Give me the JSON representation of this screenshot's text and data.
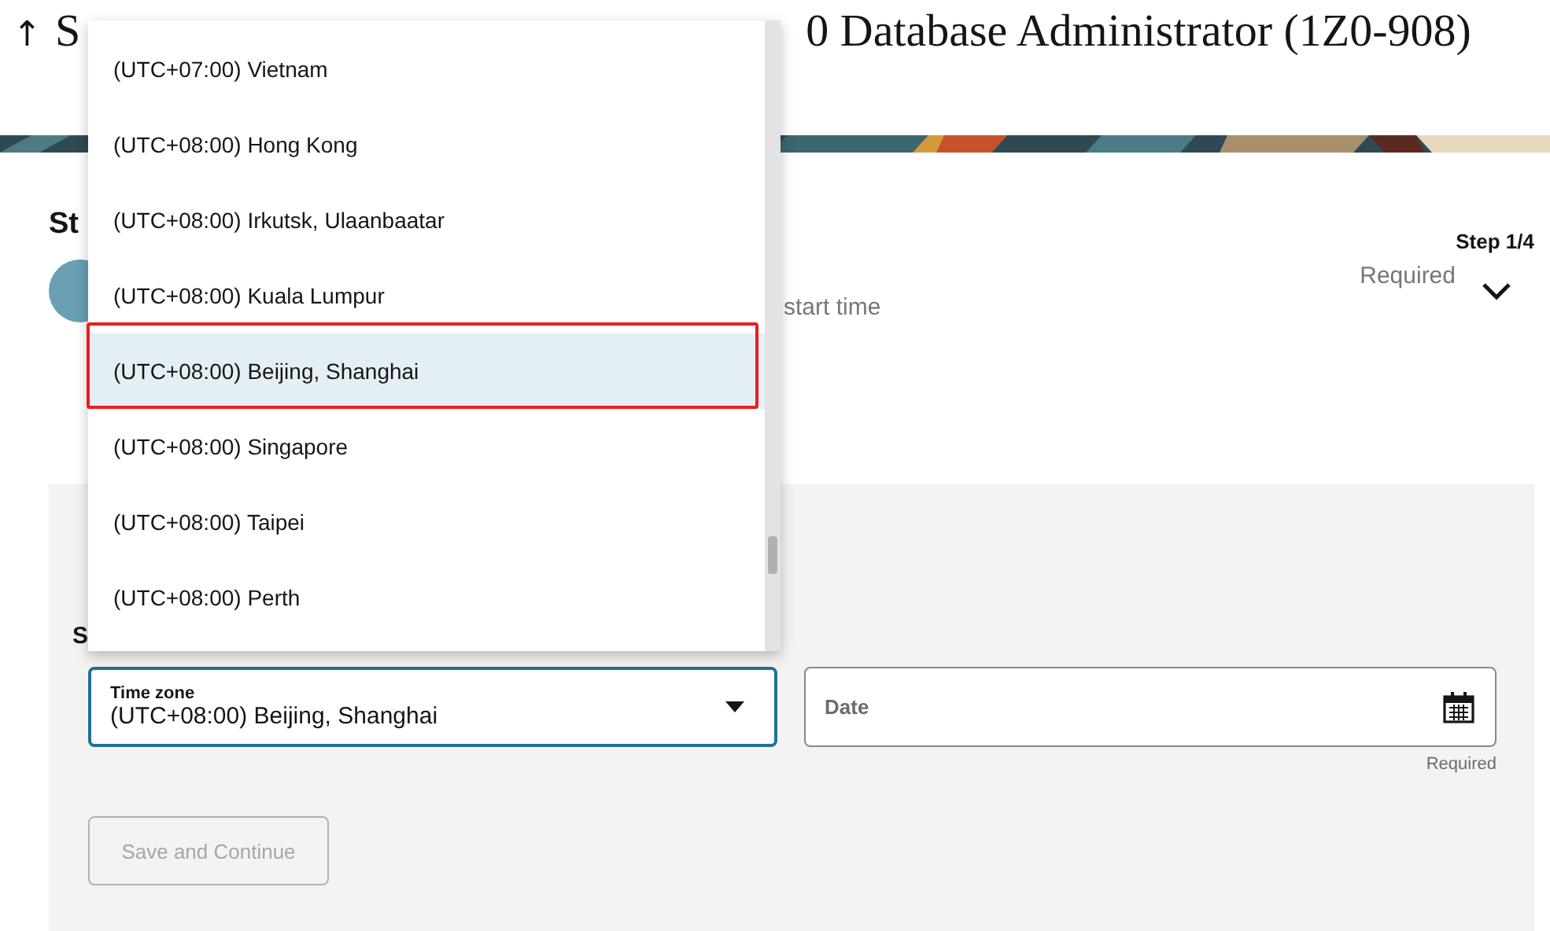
{
  "page": {
    "back_arrow": "↑",
    "title_start": "S",
    "title_end": "0 Database Administrator (1Z0-908)"
  },
  "section": {
    "heading": "St",
    "step": "Step 1/4"
  },
  "step_row": {
    "label": "start time",
    "status": "Required"
  },
  "form": {
    "label": "S",
    "time_zone": {
      "label": "Time zone",
      "value": "(UTC+08:00) Beijing, Shanghai"
    },
    "date": {
      "label": "Date",
      "hint": "Required"
    },
    "save_button": {
      "label": "Save and Continue",
      "disabled": true
    }
  },
  "dropdown": {
    "options": [
      {
        "label": "(UTC+07:00) Vietnam",
        "selected": false
      },
      {
        "label": "(UTC+08:00) Hong Kong",
        "selected": false
      },
      {
        "label": "(UTC+08:00) Irkutsk, Ulaanbaatar",
        "selected": false
      },
      {
        "label": "(UTC+08:00) Kuala Lumpur",
        "selected": false
      },
      {
        "label": "(UTC+08:00) Beijing, Shanghai",
        "selected": true
      },
      {
        "label": "(UTC+08:00) Singapore",
        "selected": false
      },
      {
        "label": "(UTC+08:00) Taipei",
        "selected": false
      },
      {
        "label": "(UTC+08:00) Perth",
        "selected": false
      }
    ]
  }
}
